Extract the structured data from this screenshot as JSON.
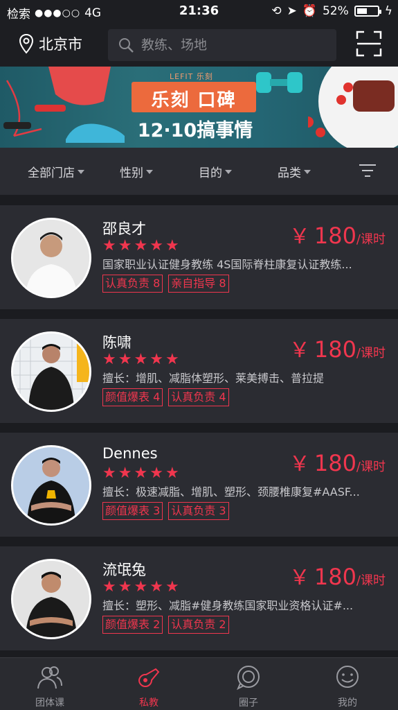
{
  "status_bar": {
    "carrier": "检索",
    "signal": "●●●○○",
    "network": "4G",
    "time": "21:36",
    "battery": "52%",
    "battery_level": 0.52
  },
  "header": {
    "city": "北京市",
    "search_placeholder": "教练、场地"
  },
  "banner": {
    "brand": "LEFIT 乐刻",
    "headline": "乐刻 口碑",
    "subline": "12·10搞事情"
  },
  "filters": [
    "全部门店",
    "性别",
    "目的",
    "品类"
  ],
  "coaches": [
    {
      "name": "邵良才",
      "rating": 5,
      "price_symbol": "￥",
      "price": "180",
      "unit": "/课时",
      "desc": "国家职业认证健身教练 4S国际脊柱康复认证教练...",
      "tags": [
        "认真负责 8",
        "亲自指导 8"
      ]
    },
    {
      "name": "陈啸",
      "rating": 5,
      "price_symbol": "￥",
      "price": "180",
      "unit": "/课时",
      "desc": "擅长：增肌、减脂体塑形、莱美搏击、普拉提",
      "tags": [
        "颜值爆表 4",
        "认真负责 4"
      ]
    },
    {
      "name": "Dennes",
      "rating": 5,
      "price_symbol": "￥",
      "price": "180",
      "unit": "/课时",
      "desc": "擅长：极速减脂、增肌、塑形、颈腰椎康复#AASF...",
      "tags": [
        "颜值爆表 3",
        "认真负责 3"
      ]
    },
    {
      "name": "流氓兔",
      "rating": 5,
      "price_symbol": "￥",
      "price": "180",
      "unit": "/课时",
      "desc": "擅长：塑形、减脂#健身教练国家职业资格认证#...",
      "tags": [
        "颜值爆表 2",
        "认真负责 2"
      ]
    }
  ],
  "tabs": [
    {
      "label": "团体课",
      "icon": "group-icon"
    },
    {
      "label": "私教",
      "icon": "whistle-icon"
    },
    {
      "label": "圈子",
      "icon": "chat-bubble-icon"
    },
    {
      "label": "我的",
      "icon": "smiley-icon"
    }
  ],
  "colors": {
    "accent": "#f0364e",
    "background": "#1b1c20",
    "card": "#2b2c32"
  }
}
